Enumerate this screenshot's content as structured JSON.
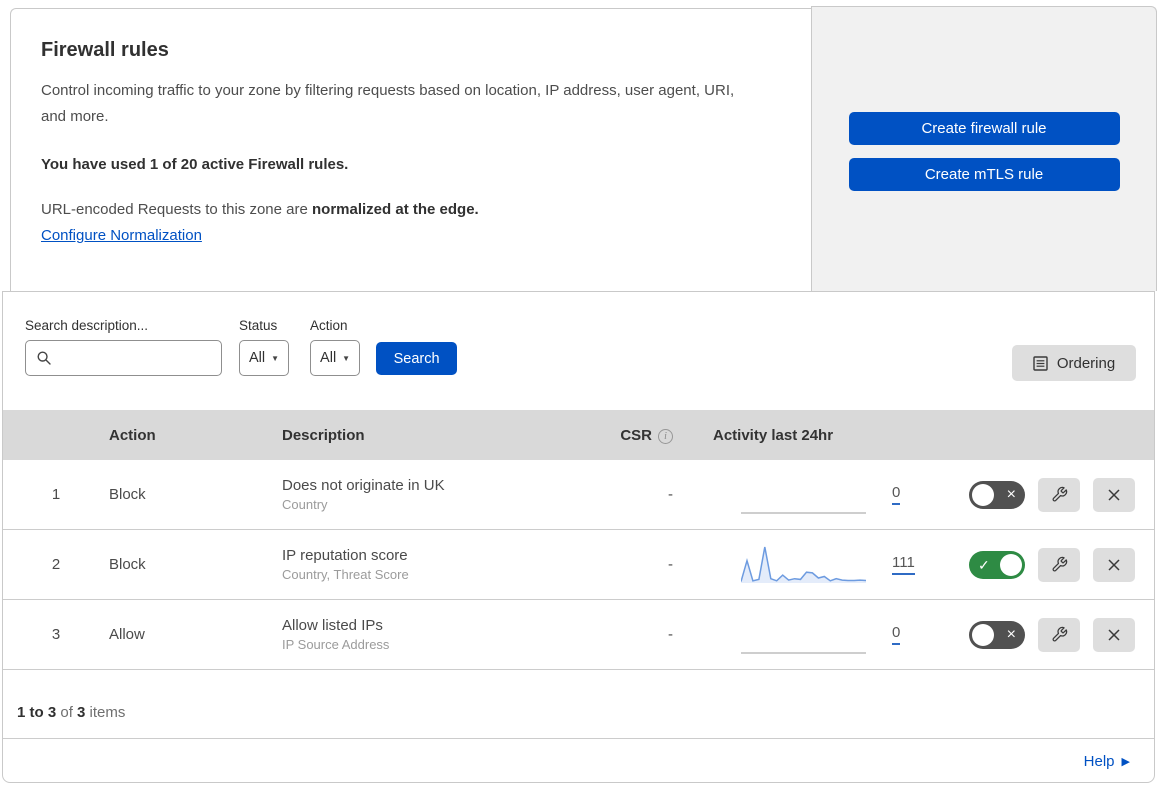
{
  "intro": {
    "title": "Firewall rules",
    "description": "Control incoming traffic to your zone by filtering requests based on location, IP address, user agent, URI, and more.",
    "usage_note": "You have used 1 of 20 active Firewall rules.",
    "normalization_text": "URL-encoded Requests to this zone are ",
    "normalization_bold": "normalized at the edge.",
    "normalization_link": "Configure Normalization"
  },
  "actions_panel": {
    "create_firewall_rule": "Create firewall rule",
    "create_mtls_rule": "Create mTLS rule"
  },
  "filters": {
    "search_label": "Search description...",
    "search_value": "",
    "status_label": "Status",
    "status_value": "All",
    "action_label": "Action",
    "action_value": "All",
    "search_button": "Search",
    "ordering_button": "Ordering"
  },
  "table": {
    "headers": {
      "action": "Action",
      "description": "Description",
      "csr": "CSR",
      "activity": "Activity last 24hr"
    },
    "rows": [
      {
        "number": "1",
        "action": "Block",
        "description": "Does not originate in UK",
        "expression_fields": "Country",
        "csr": "-",
        "activity_count": "0",
        "enabled": false,
        "sparkline": []
      },
      {
        "number": "2",
        "action": "Block",
        "description": "IP reputation score",
        "expression_fields": "Country, Threat Score",
        "csr": "-",
        "activity_count": "111",
        "enabled": true,
        "sparkline": [
          4,
          62,
          6,
          10,
          100,
          12,
          6,
          22,
          8,
          12,
          10,
          30,
          28,
          14,
          18,
          6,
          12,
          8,
          7,
          7,
          8,
          7
        ]
      },
      {
        "number": "3",
        "action": "Allow",
        "description": "Allow listed IPs",
        "expression_fields": "IP Source Address",
        "csr": "-",
        "activity_count": "0",
        "enabled": false,
        "sparkline": []
      }
    ]
  },
  "footer": {
    "range": "1 to 3",
    "of": " of ",
    "total": "3",
    "items": " items",
    "help": "Help"
  },
  "icons": {
    "check": "✓",
    "cross": "×",
    "caret": "▼",
    "help_arrow": "▶",
    "info": "i"
  },
  "colors": {
    "accent_blue": "#0051c3",
    "toggle_on_green": "#2e8b44",
    "toggle_off_gray": "#515151",
    "table_header_bg": "#d9d9d9",
    "panel_bg": "#f1f1f1",
    "gray_button_bg": "#dedede",
    "sparkline_blue": "#6d9be0"
  }
}
